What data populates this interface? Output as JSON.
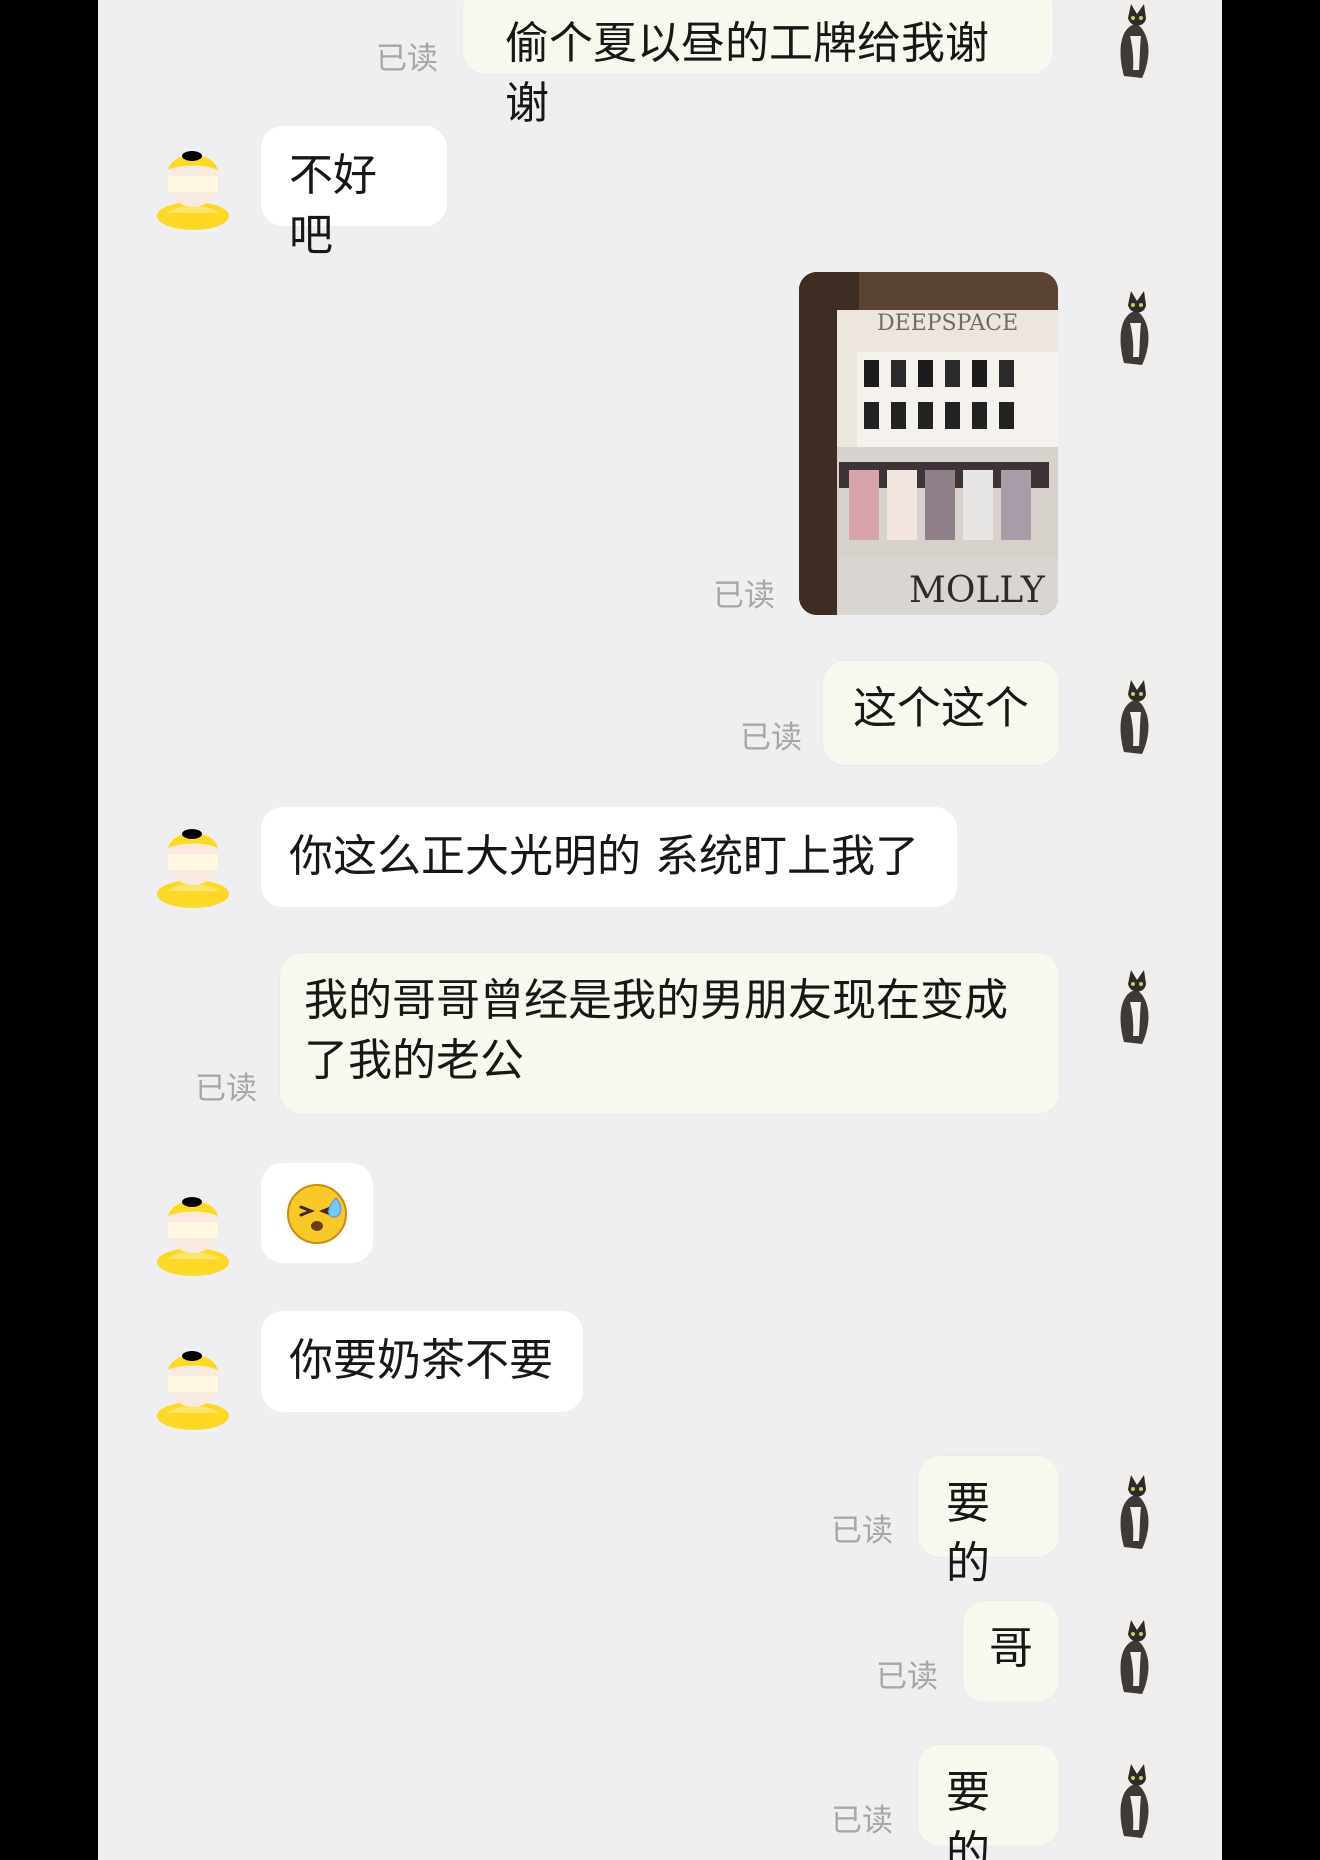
{
  "read_status": "已读",
  "messages": [
    {
      "side": "me",
      "type": "text",
      "text": "偷个夏以昼的工牌给我谢谢"
    },
    {
      "side": "them",
      "type": "text",
      "text": "不好吧"
    },
    {
      "side": "me",
      "type": "image",
      "text": "DEEPSPACE",
      "text2": "MOLLY"
    },
    {
      "side": "me",
      "type": "text",
      "text": "这个这个"
    },
    {
      "side": "them",
      "type": "text",
      "text": "你这么正大光明的 系统盯上我了"
    },
    {
      "side": "me",
      "type": "text",
      "text_line1": "我的哥哥曾经是我的男朋友现在变成",
      "text_line2": "了我的老公"
    },
    {
      "side": "them",
      "type": "emoji",
      "emoji": "sweat-squint-emoji"
    },
    {
      "side": "them",
      "type": "text",
      "text": "你要奶茶不要"
    },
    {
      "side": "me",
      "type": "text",
      "text": "要的"
    },
    {
      "side": "me",
      "type": "text",
      "text": "哥"
    },
    {
      "side": "me",
      "type": "text",
      "text": "要的"
    }
  ],
  "colors": {
    "background": "#efeff1",
    "frame": "#000000",
    "bubble_me": "#f8f8ef",
    "bubble_them": "#ffffff",
    "read_text": "#a7a7a7",
    "duck_yellow": "#ffd824"
  },
  "icons": {
    "me_avatar": "cat-avatar-icon",
    "them_avatar": "duck-avatar-icon"
  }
}
